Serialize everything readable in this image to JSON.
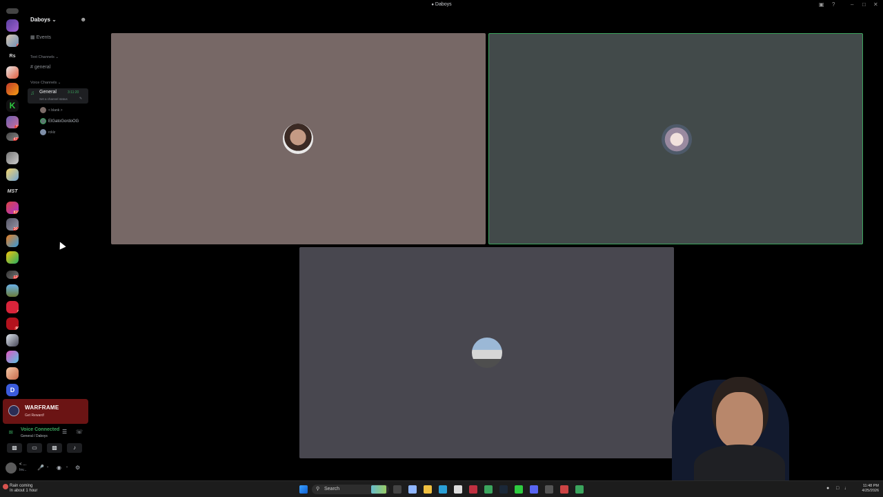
{
  "window": {
    "title": "Daboys",
    "controls": [
      "inbox-icon",
      "help-icon",
      "minimize",
      "maximize",
      "close"
    ]
  },
  "server": {
    "name": "Daboys"
  },
  "rail": {
    "text_items": [
      "Rs",
      "MST"
    ],
    "badges": [
      "6",
      "72",
      "477",
      "810",
      "364",
      "124",
      "8",
      "90"
    ]
  },
  "sidebar": {
    "events_label": "Events",
    "text_category": "Text Channels",
    "text_channel": "general",
    "voice_category": "Voice Channels",
    "voice_channel": {
      "name": "General",
      "timer": "3:11:20",
      "status": "Set a channel status"
    },
    "members": [
      "< blank >",
      "ElGatoGordoOG",
      "rcklz"
    ]
  },
  "promo": {
    "title": "WARFRAME",
    "subtitle": "Get Reward!"
  },
  "voice_panel": {
    "status": "Voice Connected",
    "location": "General / Daboys"
  },
  "user": {
    "name": "< ...",
    "status": "Inv..."
  },
  "taskbar": {
    "weather_line1": "Rain coming",
    "weather_line2": "In about 1 hour",
    "search_placeholder": "Search",
    "time": "11:48 PM",
    "date": "4/25/2026"
  },
  "colors": {
    "speaking": "#3ba55d",
    "promo_bg": "#6b1414",
    "tile1": "#776866",
    "tile2": "#424a4a",
    "tile3": "#48474f"
  }
}
